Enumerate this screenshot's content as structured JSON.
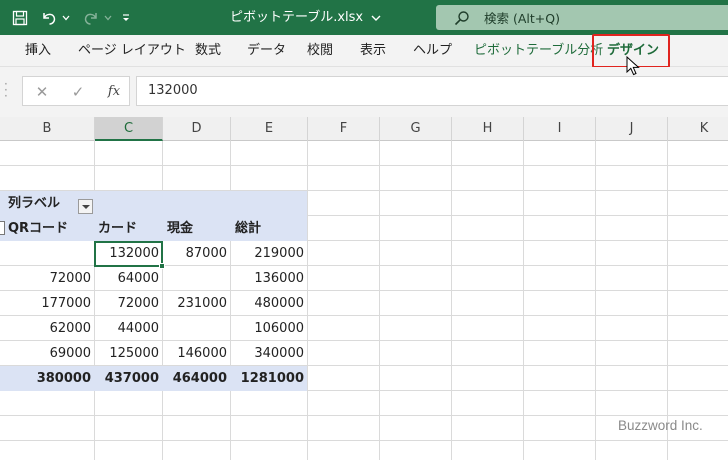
{
  "titlebar": {
    "filename": "ピボットテーブル.xlsx",
    "search_label": "検索 (Alt+Q)"
  },
  "ribbon": {
    "tabs": [
      {
        "label": "挿入"
      },
      {
        "label": "ページ レイアウト"
      },
      {
        "label": "数式"
      },
      {
        "label": "データ"
      },
      {
        "label": "校閲"
      },
      {
        "label": "表示"
      },
      {
        "label": "ヘルプ"
      },
      {
        "label": "ピボットテーブル分析"
      },
      {
        "label": "デザイン"
      }
    ]
  },
  "formula_bar": {
    "cancel": "✕",
    "enter": "✓",
    "fx": "fx",
    "value": "132000"
  },
  "columns": [
    "B",
    "C",
    "D",
    "E",
    "F",
    "G",
    "H",
    "I",
    "J",
    "K"
  ],
  "selected_column": "C",
  "pivot": {
    "col_label": "列ラベル",
    "headers": [
      "QRコード",
      "カード",
      "現金",
      "総計"
    ],
    "rows": [
      [
        "",
        "132000",
        "87000",
        "219000"
      ],
      [
        "72000",
        "64000",
        "",
        "136000"
      ],
      [
        "177000",
        "72000",
        "231000",
        "480000"
      ],
      [
        "62000",
        "44000",
        "",
        "106000"
      ],
      [
        "69000",
        "125000",
        "146000",
        "340000"
      ]
    ],
    "totals": [
      "380000",
      "437000",
      "464000",
      "1281000"
    ]
  },
  "watermark": "Buzzword Inc."
}
